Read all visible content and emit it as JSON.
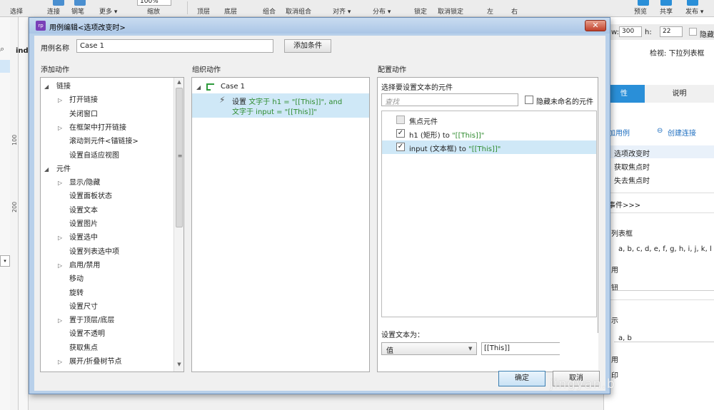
{
  "toolbar": {
    "items": [
      "选择",
      "连接",
      "钢笔",
      "更多 ▾",
      "100%",
      "缩放",
      "顶层",
      "底层",
      "组合",
      "取消组合",
      "对齐 ▾",
      "分布 ▾",
      "锁定",
      "取消锁定",
      "左",
      "右",
      "预览",
      "共享",
      "发布 ▾"
    ]
  },
  "left": {
    "doc_tab": "ind",
    "ruler": [
      "100",
      "200"
    ]
  },
  "right_panel": {
    "w_label": "w:",
    "w_value": "300",
    "h_label": "h:",
    "h_value": "22",
    "hide_label": "隐藏",
    "inspect_label": "检视: 下拉列表框",
    "title_fragment": "t",
    "tab_properties": "性",
    "tab_notes": "说明",
    "add_case": "加用例",
    "create_link": "创建连接",
    "events": [
      "选项改变时",
      "获取焦点时",
      "失去焦点时"
    ],
    "more_events": "事件>>>",
    "list_box": "列表框",
    "list_values": "a, b, c, d, e, f, g, h, i, j, k, l",
    "use": "用",
    "button": "钮",
    "show": "示",
    "short_values": "a, b",
    "use2": "用",
    "last": "印"
  },
  "dialog": {
    "app_icon": "rp",
    "title": "用例编辑<选项改变时>",
    "case_name_label": "用例名称",
    "case_name_value": "Case 1",
    "add_condition": "添加条件",
    "add_action_label": "添加动作",
    "org_action_label": "组织动作",
    "config_action_label": "配置动作",
    "tree": [
      {
        "label": "链接",
        "level": 0,
        "arrow": "expanded"
      },
      {
        "label": "打开链接",
        "level": 1,
        "arrow": "collapsed"
      },
      {
        "label": "关闭窗口",
        "level": 1,
        "arrow": "none"
      },
      {
        "label": "在框架中打开链接",
        "level": 1,
        "arrow": "collapsed"
      },
      {
        "label": "滚动到元件<锚链接>",
        "level": 1,
        "arrow": "none"
      },
      {
        "label": "设置自适应视图",
        "level": 1,
        "arrow": "none"
      },
      {
        "label": "元件",
        "level": 0,
        "arrow": "expanded"
      },
      {
        "label": "显示/隐藏",
        "level": 1,
        "arrow": "collapsed"
      },
      {
        "label": "设置面板状态",
        "level": 1,
        "arrow": "none"
      },
      {
        "label": "设置文本",
        "level": 1,
        "arrow": "none"
      },
      {
        "label": "设置图片",
        "level": 1,
        "arrow": "none"
      },
      {
        "label": "设置选中",
        "level": 1,
        "arrow": "collapsed"
      },
      {
        "label": "设置列表选中项",
        "level": 1,
        "arrow": "none"
      },
      {
        "label": "启用/禁用",
        "level": 1,
        "arrow": "collapsed"
      },
      {
        "label": "移动",
        "level": 1,
        "arrow": "none"
      },
      {
        "label": "旋转",
        "level": 1,
        "arrow": "none"
      },
      {
        "label": "设置尺寸",
        "level": 1,
        "arrow": "none"
      },
      {
        "label": "置于顶层/底层",
        "level": 1,
        "arrow": "collapsed"
      },
      {
        "label": "设置不透明",
        "level": 1,
        "arrow": "none"
      },
      {
        "label": "获取焦点",
        "level": 1,
        "arrow": "none"
      },
      {
        "label": "展开/折叠树节点",
        "level": 1,
        "arrow": "collapsed"
      }
    ],
    "org": {
      "case_label": "Case 1",
      "action_prefix": "设置",
      "action_line1": "文字于 h1 = \"[[This]]\", and",
      "action_line2": "文字于 input = \"[[This]]\""
    },
    "config": {
      "select_label": "选择要设置文本的元件",
      "search_placeholder": "查找",
      "hide_unnamed": "隐藏未命名的元件",
      "widgets": [
        {
          "label": "焦点元件",
          "checked": false,
          "disabled": true,
          "prefix": "",
          "suffix": ""
        },
        {
          "label": "h1 (矩形) to ",
          "checked": true,
          "disabled": false,
          "suffix": "\"[[This]]\""
        },
        {
          "label": "input (文本框) to ",
          "checked": true,
          "disabled": false,
          "suffix": "\"[[This]]\""
        }
      ],
      "set_text_label": "设置文本为：",
      "value_type": "值",
      "value": "[[This]]"
    },
    "ok": "确定",
    "cancel": "取消"
  },
  "watermark": "jingyan.b"
}
